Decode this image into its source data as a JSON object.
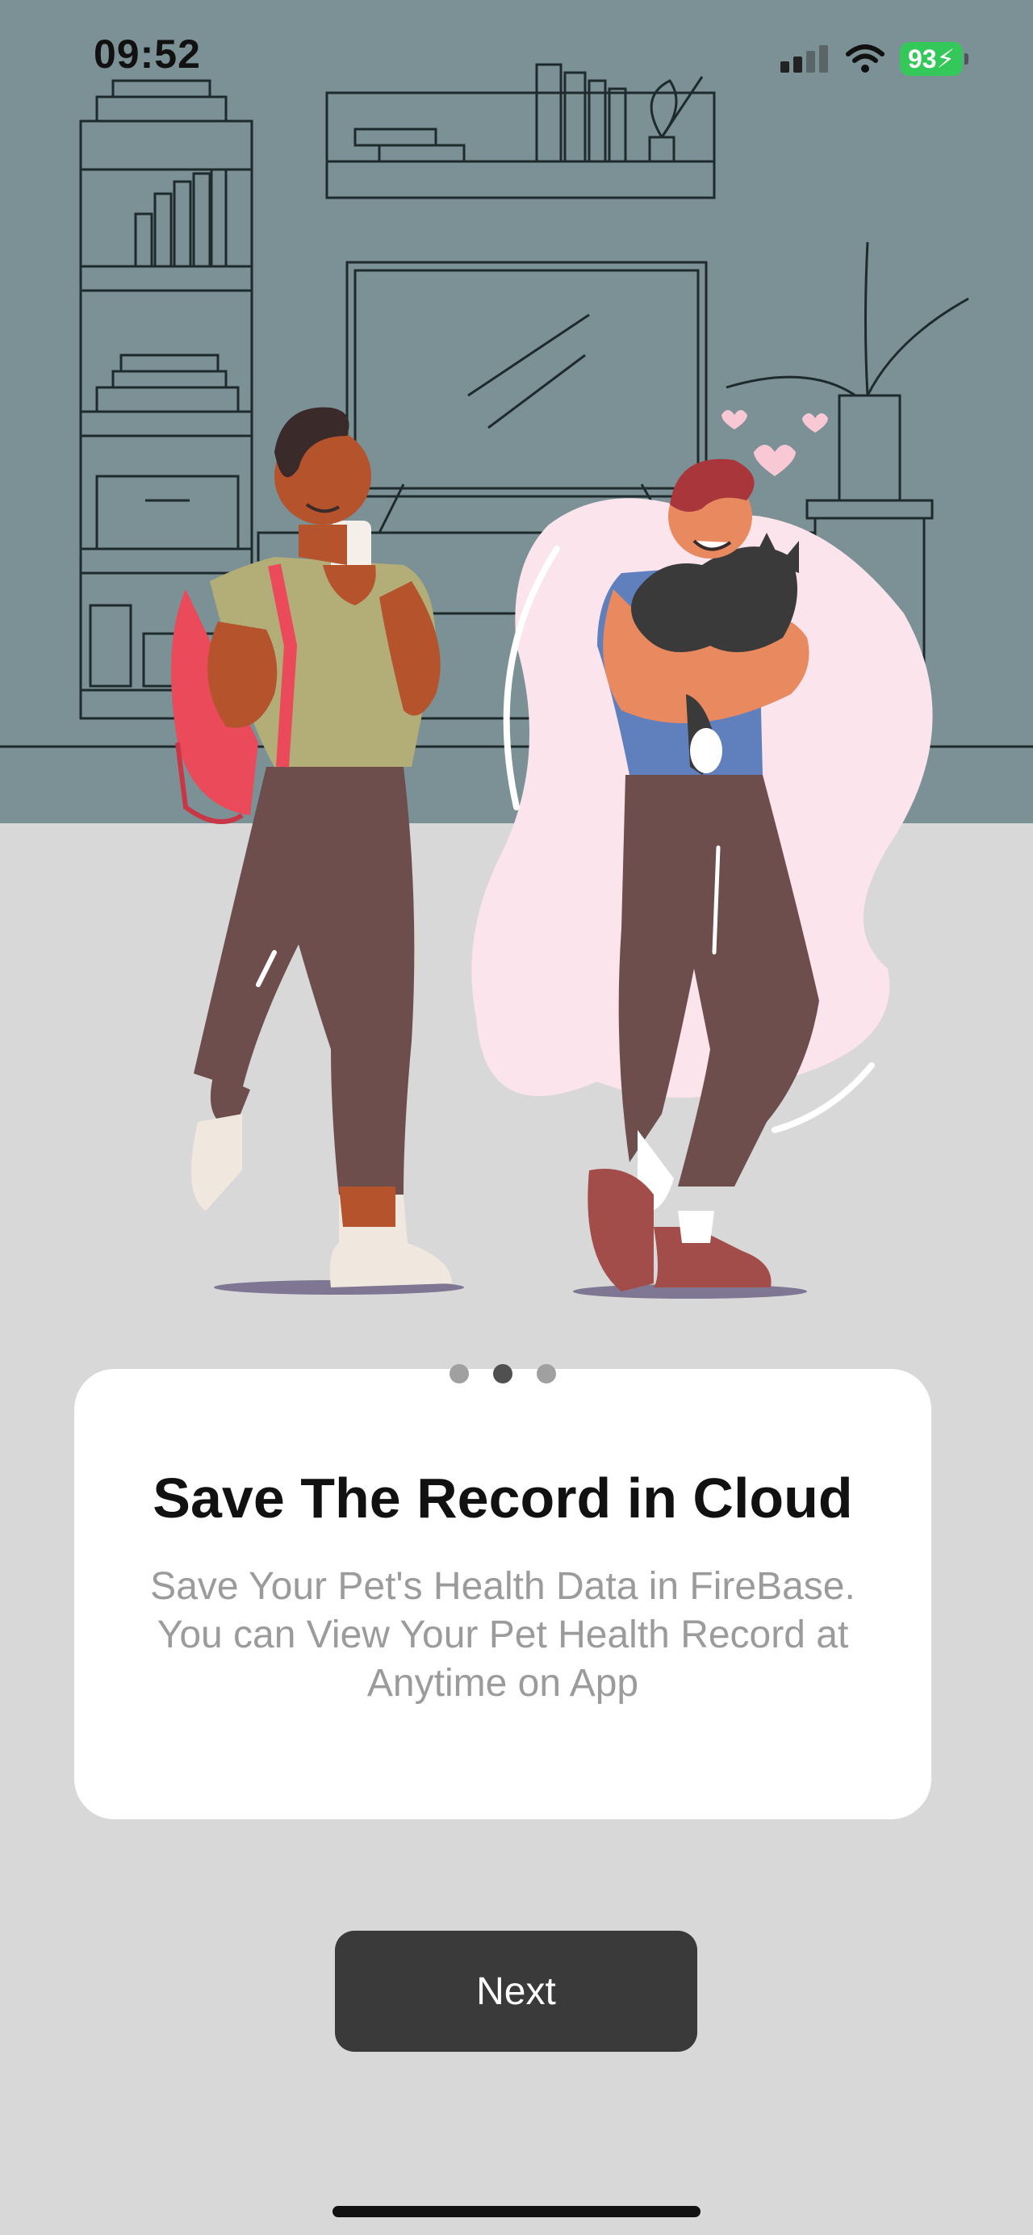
{
  "status_bar": {
    "time": "09:52",
    "battery": "93"
  },
  "onboarding": {
    "pager": {
      "total": 3,
      "active_index": 1
    },
    "title": "Save The Record in Cloud",
    "description": "Save Your Pet's Health Data in FireBase. You can View Your Pet Health Record at Anytime on App"
  },
  "actions": {
    "next_label": "Next"
  },
  "colors": {
    "background": "#d8d8d8",
    "scene_backdrop": "#7b9196",
    "card": "#ffffff",
    "button": "#3a3a3a",
    "battery": "#34c759",
    "pink_blob": "#fce4ec"
  }
}
